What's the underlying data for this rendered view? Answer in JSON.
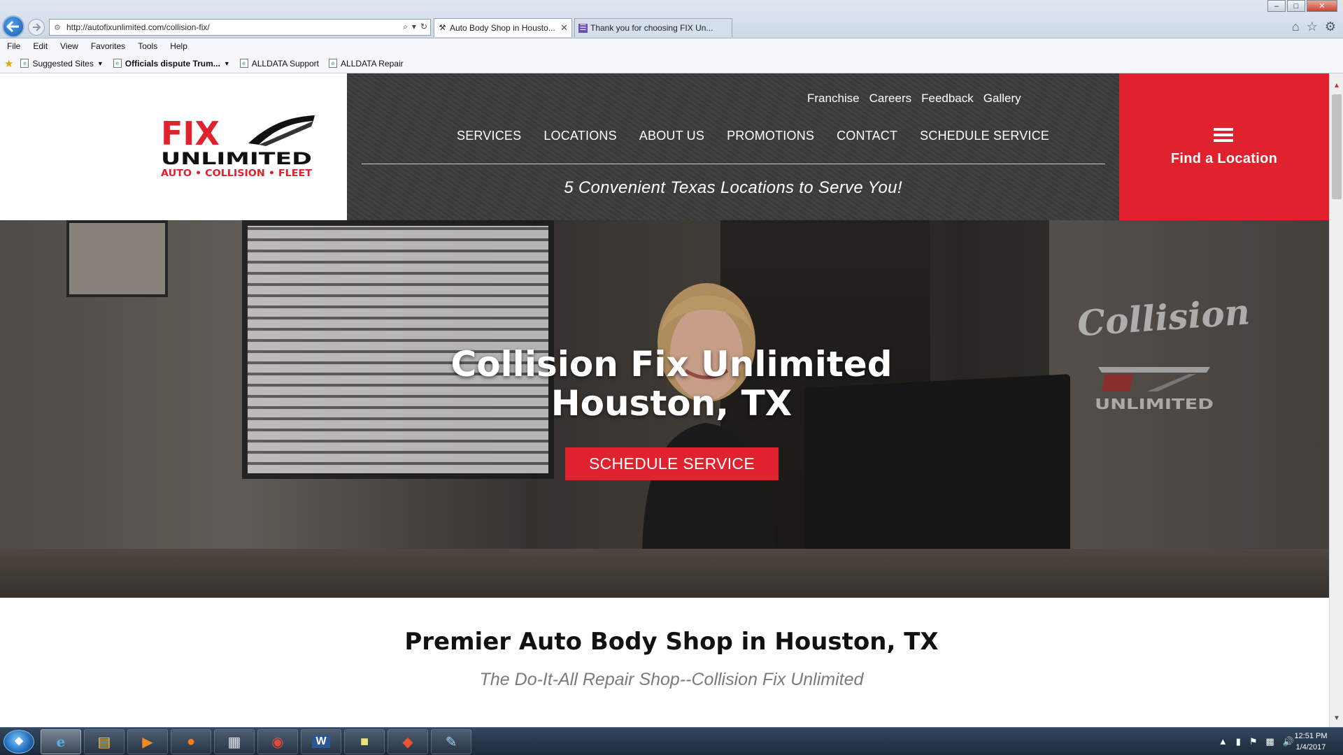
{
  "browser": {
    "address": "http://autofixunlimited.com/collision-fix/",
    "tabs": [
      {
        "label": "Auto Body Shop in Housto...",
        "active": true
      },
      {
        "label": "Thank you for choosing FIX Un...",
        "active": false
      }
    ],
    "menu": [
      "File",
      "Edit",
      "View",
      "Favorites",
      "Tools",
      "Help"
    ],
    "favorites": [
      {
        "label": "Suggested Sites",
        "dropdown": true,
        "bold": false
      },
      {
        "label": "Officials dispute Trum...",
        "dropdown": true,
        "bold": true
      },
      {
        "label": "ALLDATA Support",
        "dropdown": false,
        "bold": false
      },
      {
        "label": "ALLDATA Repair",
        "dropdown": false,
        "bold": false
      }
    ]
  },
  "site": {
    "logo": {
      "brand": "FIX",
      "name": "UNLIMITED",
      "tagline": "AUTO • COLLISION • FLEET"
    },
    "util_nav": [
      "Franchise",
      "Careers",
      "Feedback",
      "Gallery"
    ],
    "main_nav": [
      "SERVICES",
      "LOCATIONS",
      "ABOUT US",
      "PROMOTIONS",
      "CONTACT",
      "SCHEDULE SERVICE"
    ],
    "header_tagline": "5 Convenient Texas Locations to Serve You!",
    "find_location": "Find a Location",
    "hero": {
      "title_line1": "Collision Fix Unlimited",
      "title_line2": "Houston, TX",
      "cta": "SCHEDULE SERVICE",
      "glass_text": "Collision",
      "glass_logo": "UNLIMITED"
    },
    "content": {
      "title": "Premier Auto Body Shop in Houston, TX",
      "subtitle": "The Do-It-All Repair Shop--Collision Fix Unlimited"
    }
  },
  "taskbar": {
    "apps": [
      {
        "icon": "internet-explorer-icon",
        "active": true
      },
      {
        "icon": "folder-icon",
        "active": false
      },
      {
        "icon": "media-player-icon",
        "active": false
      },
      {
        "icon": "firefox-icon",
        "active": false
      },
      {
        "icon": "calculator-icon",
        "active": false
      },
      {
        "icon": "chrome-icon",
        "active": false
      },
      {
        "icon": "word-icon",
        "active": false
      },
      {
        "icon": "sticky-notes-icon",
        "active": false
      },
      {
        "icon": "git-icon",
        "active": false
      },
      {
        "icon": "paint-icon",
        "active": false
      }
    ],
    "time": "12:51 PM",
    "date": "1/4/2017"
  },
  "colors": {
    "brand_red": "#e0212e",
    "header_dark": "#3c3c3c",
    "subtitle_gray": "#7b7b7b"
  }
}
